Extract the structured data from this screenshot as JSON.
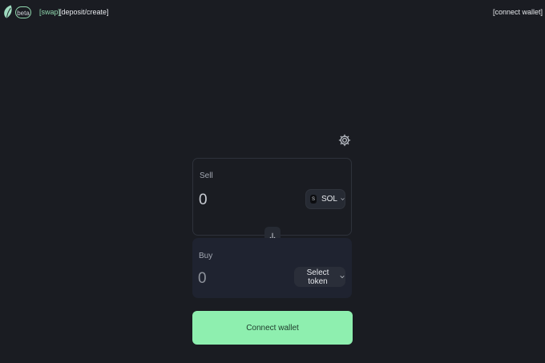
{
  "header": {
    "beta_badge": "beta",
    "nav": {
      "swap": "[swap]",
      "deposit_create": "[deposit/create]"
    },
    "connect_wallet": "[connect wallet]"
  },
  "swap": {
    "settings_icon": "gear-icon",
    "sell": {
      "label": "Sell",
      "amount_placeholder": "0",
      "token": {
        "badge": "S",
        "symbol": "SOL",
        "icon": "chevron-down-icon"
      }
    },
    "switch_icon": "arrow-down-icon",
    "buy": {
      "label": "Buy",
      "amount_placeholder": "0",
      "token": {
        "label": "Select token",
        "icon": "chevron-down-icon"
      }
    },
    "connect_button": "Connect wallet"
  },
  "colors": {
    "background": "#1a1c22",
    "accent": "#8eefaf",
    "nav_active": "#8fd6ad",
    "buy_panel": "#1f2330"
  }
}
